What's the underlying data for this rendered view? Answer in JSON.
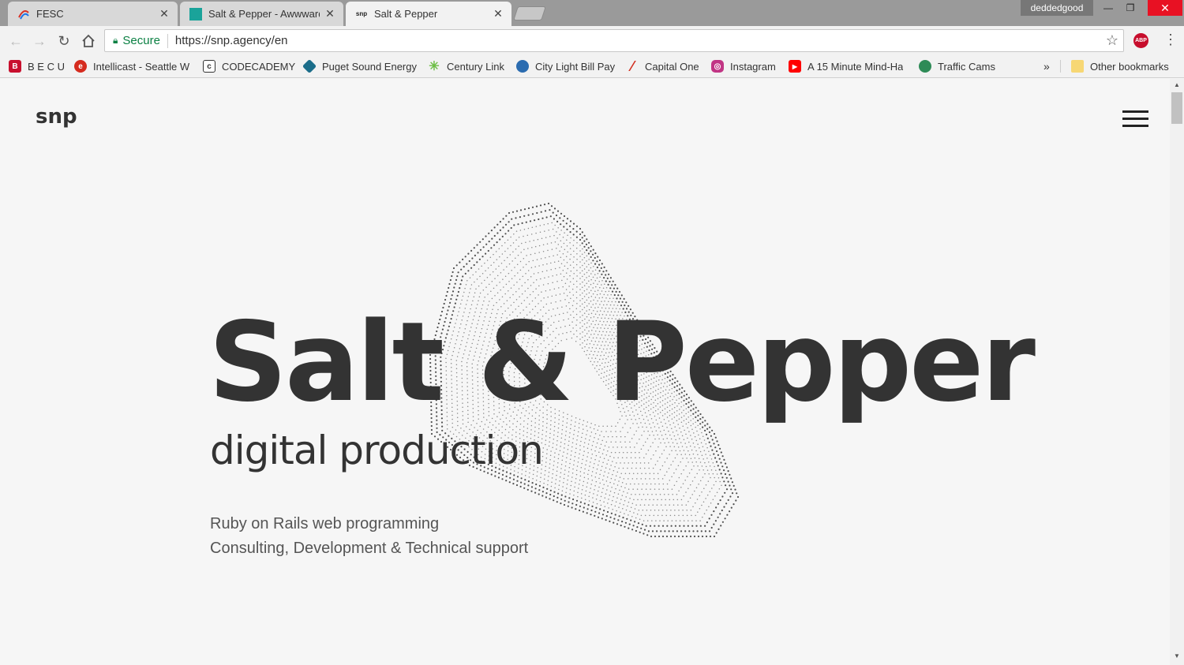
{
  "browser": {
    "tabs": [
      {
        "title": "FESC",
        "active": false,
        "favicon": "fesc-logo-icon"
      },
      {
        "title": "Salt & Pepper - Awwwards",
        "active": false,
        "favicon": "awwwards-icon"
      },
      {
        "title": "Salt & Pepper",
        "active": true,
        "favicon": "snp-icon",
        "favicon_text": "snp"
      }
    ],
    "profile_name": "deddedgood",
    "address": {
      "secure_label": "Secure",
      "url": "https://snp.agency/en"
    },
    "bookmarks": [
      {
        "label": "B E C U",
        "icon": "becu-icon",
        "color": "#c8102e",
        "glyph": "B"
      },
      {
        "label": "Intellicast - Seattle W",
        "icon": "intellicast-icon",
        "color": "#d52b1e",
        "glyph": "e"
      },
      {
        "label": "CODECADEMY",
        "icon": "codecademy-icon",
        "color": "#ffffff",
        "glyph": "c"
      },
      {
        "label": "Puget Sound Energy",
        "icon": "pse-icon",
        "color": "#1b6d8a",
        "glyph": "◆"
      },
      {
        "label": "Century Link",
        "icon": "centurylink-icon",
        "color": "#6cbe45",
        "glyph": "✳"
      },
      {
        "label": "City Light Bill Pay",
        "icon": "seattle-city-light-icon",
        "color": "#2b6cb0",
        "glyph": "●"
      },
      {
        "label": "Capital One",
        "icon": "capital-one-icon",
        "color": "#d22e1e",
        "glyph": "/"
      },
      {
        "label": "Instagram",
        "icon": "instagram-icon",
        "color": "#c13584",
        "glyph": "◎"
      },
      {
        "label": "A 15 Minute Mind-Ha",
        "icon": "youtube-icon",
        "color": "#ff0000",
        "glyph": "▶"
      },
      {
        "label": "Traffic Cams",
        "icon": "traffic-cams-icon",
        "color": "#2e8b57",
        "glyph": "◉"
      }
    ],
    "bookmarks_overflow": "»",
    "other_bookmarks": "Other bookmarks"
  },
  "site": {
    "logo": "snp",
    "hero_title": "Salt & Pepper",
    "hero_subtitle": "digital production",
    "description_lines": [
      "Ruby on Rails web programming",
      "Consulting, Development & Technical support"
    ]
  }
}
